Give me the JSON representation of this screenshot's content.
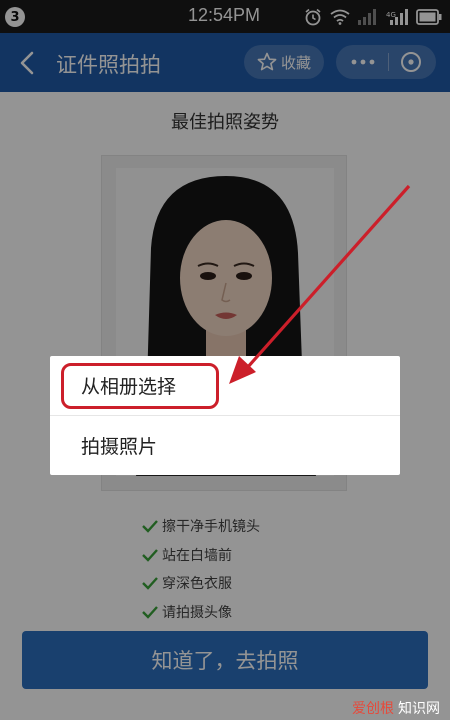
{
  "status_bar": {
    "notification_count": "3",
    "time": "12:54PM",
    "icons": [
      "alarm-icon",
      "wifi-icon",
      "signal-icon",
      "signal-icon",
      "battery-icon"
    ]
  },
  "toolbar": {
    "back_icon": "chevron-left-icon",
    "title": "证件照拍拍",
    "favorite_label": "收藏",
    "favorite_icon": "star-outline-icon",
    "more_icon": "more-icon",
    "close_icon": "close-circle-icon"
  },
  "main": {
    "heading": "最佳拍照姿势",
    "tips": [
      "擦干净手机镜头",
      "站在白墙前",
      "穿深色衣服",
      "请拍摄头像"
    ],
    "cta_label": "知道了，去拍照"
  },
  "action_sheet": {
    "items": [
      {
        "label": "从相册选择",
        "highlighted": true
      },
      {
        "label": "拍摄照片",
        "highlighted": false
      }
    ]
  },
  "watermark": {
    "part1": "爱创根",
    "part2": "知识网"
  },
  "colors": {
    "toolbar": "#1f5aa8",
    "cta": "#2c6fbd",
    "check": "#3aa23a",
    "annotation": "#cc1f2a"
  }
}
